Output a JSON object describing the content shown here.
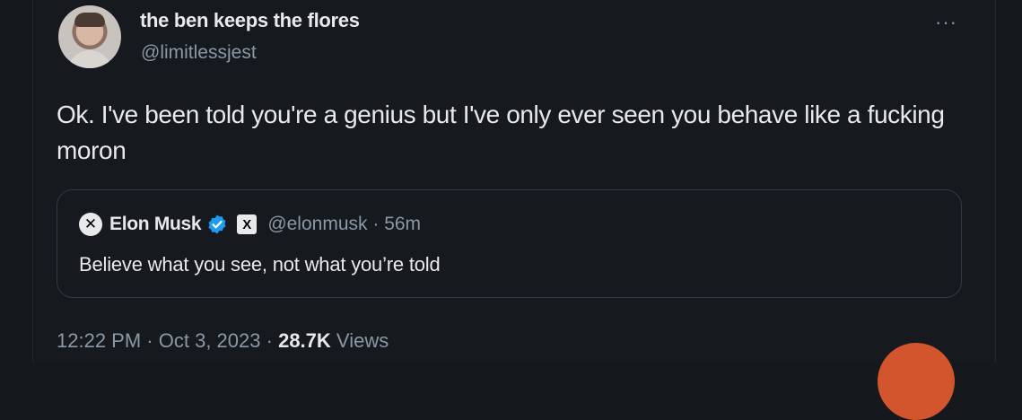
{
  "tweet": {
    "display_name": "the ben keeps the flores",
    "handle": "@limitlessjest",
    "more_icon": "more-horizontal-icon",
    "text": "Ok. I've been told you're a genius but I've only ever seen you behave like a fucking moron"
  },
  "quoted_tweet": {
    "name": "Elon Musk",
    "verified": true,
    "verified_color": "#1d9bf0",
    "affiliate_badge": "X",
    "handle": "@elonmusk",
    "separator": "·",
    "time_ago": "56m",
    "text": "Believe what you see, not what you’re told"
  },
  "footer": {
    "time": "12:22 PM",
    "sep1": "·",
    "date": "Oct 3, 2023",
    "sep2": "·",
    "views_count": "28.7K",
    "views_label": "Views"
  },
  "colors": {
    "background": "#15181d",
    "text_primary": "#e7e9ea",
    "text_secondary": "#8b98a5",
    "border": "#333a42"
  }
}
